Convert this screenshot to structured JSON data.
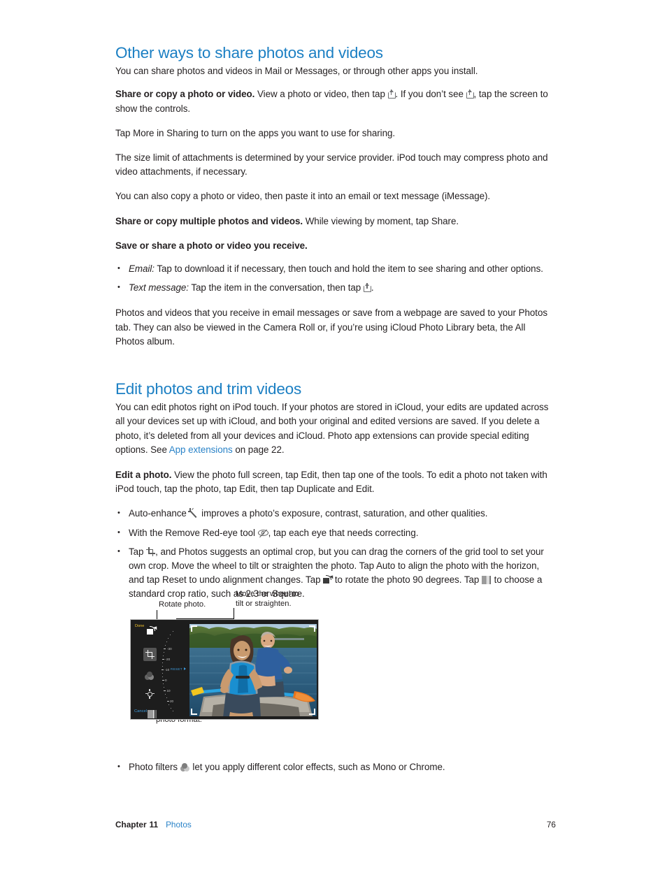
{
  "sections": {
    "share": {
      "title": "Other ways to share photos and videos",
      "intro": "You can share photos and videos in Mail or Messages, or through other apps you install.",
      "p1_lead": "Share or copy a photo or video.",
      "p1_a": " View a photo or video, then tap ",
      "p1_b": ". If you don’t see ",
      "p1_c": ", tap the screen to show the controls.",
      "p2": "Tap More in Sharing to turn on the apps you want to use for sharing.",
      "p3": "The size limit of attachments is determined by your service provider. iPod touch may compress photo and video attachments, if necessary.",
      "p4": "You can also copy a photo or video, then paste it into an email or text message (iMessage).",
      "p5_lead": "Share or copy multiple photos and videos.",
      "p5_rest": " While viewing by moment, tap Share.",
      "p6_lead": "Save or share a photo or video you receive.",
      "bullet_email_label": "Email:",
      "bullet_email_text": " Tap to download it if necessary, then touch and hold the item to see sharing and other options.",
      "bullet_text_label": "Text message:",
      "bullet_text_text": " Tap the item in the conversation, then tap ",
      "bullet_text_end": ".",
      "p7": "Photos and videos that you receive in email messages or save from a webpage are saved to your Photos tab. They can also be viewed in the Camera Roll or, if you’re using iCloud Photo Library beta, the All Photos album."
    },
    "edit": {
      "title": "Edit photos and trim videos",
      "intro_a": "You can edit photos right on iPod touch. If your photos are stored in iCloud, your edits are updated across all your devices set up with iCloud, and both your original and edited versions are saved. If you delete a photo, it’s deleted from all your devices and iCloud. Photo app extensions can provide special editing options. See ",
      "intro_link": "App extensions",
      "intro_b": " on page 22.",
      "p1_lead": "Edit a photo.",
      "p1_rest": " View the photo full screen, tap Edit, then tap one of the tools. To edit a photo not taken with iPod touch, tap the photo, tap Edit, then tap Duplicate and Edit.",
      "b1_a": "Auto-enhance ",
      "b1_b": " improves a photo’s exposure, contrast, saturation, and other qualities.",
      "b2_a": "With the Remove Red-eye tool ",
      "b2_b": ", tap each eye that needs correcting.",
      "b3_a": "Tap ",
      "b3_b": ", and Photos suggests an optimal crop, but you can drag the corners of the grid tool to set your own crop. Move the wheel to tilt or straighten the photo. Tap Auto to align the photo with the horizon, and tap Reset to undo alignment changes. Tap ",
      "b3_c": " to rotate the photo 90 degrees. Tap ",
      "b3_d": " to choose a standard crop ratio, such as 2:3 or Square.",
      "b4_a": "Photo filters ",
      "b4_b": " let you apply different color effects, such as Mono or Chrome."
    }
  },
  "figure": {
    "callout_rotate": "Rotate photo.",
    "callout_wheel": "Move the wheel to\ntilt or straighten.",
    "callout_format": "Choose a standard\nphoto format.",
    "device": {
      "done_label": "Done",
      "cancel_label": "Cancel",
      "reset_label": "RESET",
      "dial_labels": [
        "-30",
        "-20",
        "-10",
        "0",
        "10",
        "20"
      ]
    }
  },
  "footer": {
    "chapter_label": "Chapter",
    "chapter_number": "11",
    "chapter_name": "Photos",
    "page_number": "76"
  },
  "colors": {
    "heading_blue": "#1b7fc3",
    "link_blue": "#2a83c8",
    "text": "#231f20",
    "device_bg": "#1d1d1d",
    "done_yellow": "#f2c32c",
    "cancel_blue": "#3e9bdd"
  }
}
